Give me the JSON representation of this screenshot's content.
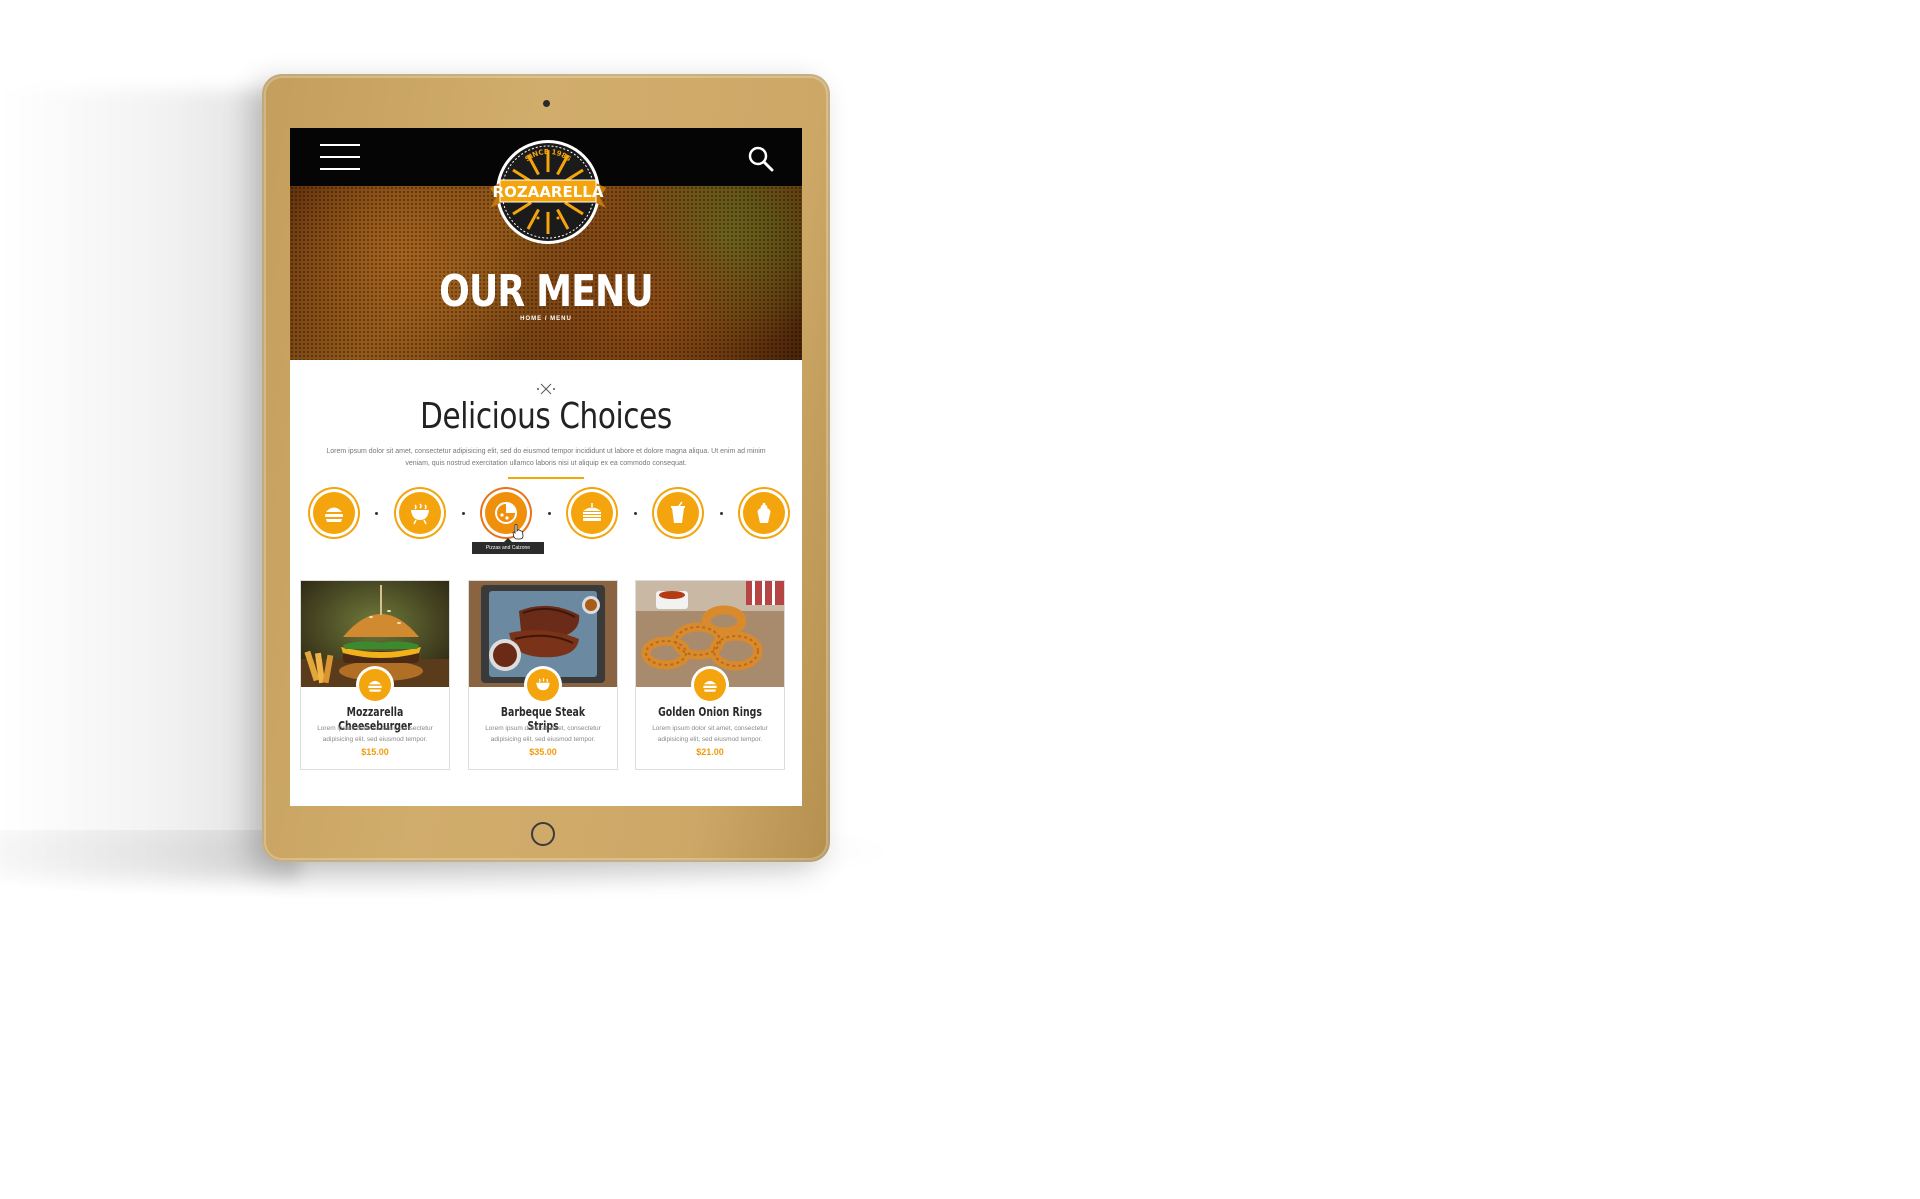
{
  "logo": {
    "top_text": "SINCE 1985",
    "name": "ROZAARELLA"
  },
  "hero": {
    "title": "OUR MENU",
    "breadcrumb": "HOME / MENU"
  },
  "section": {
    "title": "Delicious Choices",
    "description": "Lorem ipsum dolor sit amet, consectetur adipisicing elit, sed do eiusmod tempor incididunt ut labore et dolore magna aliqua. Ut enim ad minim veniam, quis nostrud exercitation ullamco laboris nisi ut aliquip ex ea commodo consequat."
  },
  "categories": [
    {
      "icon": "burger-icon"
    },
    {
      "icon": "grill-icon"
    },
    {
      "icon": "pizza-icon",
      "active": true
    },
    {
      "icon": "sandwich-icon"
    },
    {
      "icon": "drink-icon"
    },
    {
      "icon": "dessert-icon"
    }
  ],
  "tooltip": "Pizzas and Calzone",
  "items": [
    {
      "name": "Mozzarella Cheeseburger",
      "description": "Lorem ipsum dolor sit amet, consectetur adipisicing elit, sed eiusmod tempor.",
      "price": "$15.00"
    },
    {
      "name": "Barbeque Steak Strips",
      "description": "Lorem ipsum dolor sit amet, consectetur adipisicing elit, sed eiusmod tempor.",
      "price": "$35.00"
    },
    {
      "name": "Golden Onion Rings",
      "description": "Lorem ipsum dolor sit amet, consectetur adipisicing elit, sed eiusmod tempor.",
      "price": "$21.00"
    }
  ],
  "colors": {
    "accent": "#f4a40c",
    "price": "#f29a0a",
    "frame": "#cda766",
    "topbar": "#050505"
  }
}
